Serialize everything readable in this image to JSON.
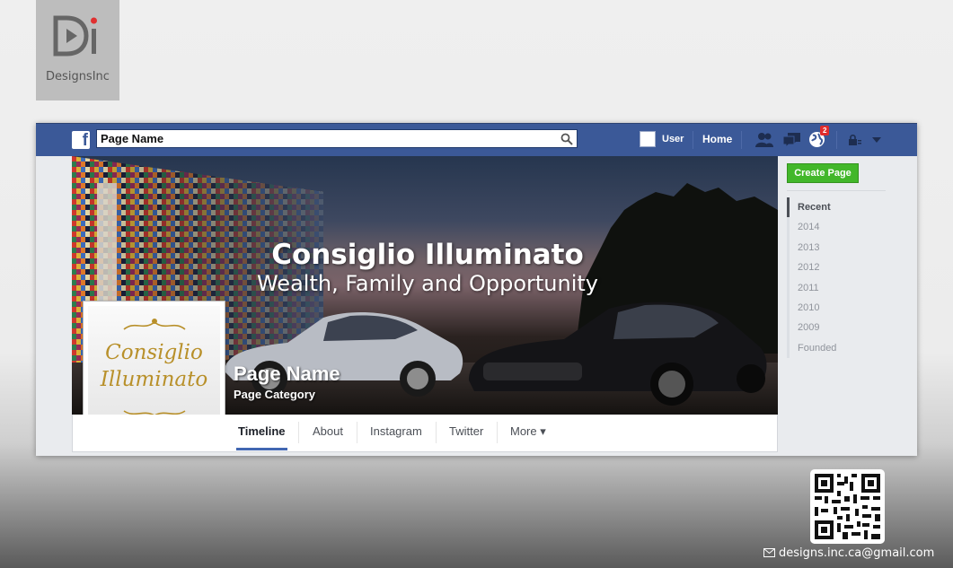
{
  "brand": {
    "name": "DesignsInc"
  },
  "topbar": {
    "search_value": "Page Name",
    "user_label": "User",
    "home_label": "Home",
    "notification_count": "2"
  },
  "cover": {
    "title": "Consiglio Illuminato",
    "subtitle": "Wealth, Family and Opportunity"
  },
  "page": {
    "name": "Page Name",
    "category": "Page Category",
    "logo_line1": "Consiglio",
    "logo_line2": "Illuminato"
  },
  "tabs": [
    {
      "label": "Timeline"
    },
    {
      "label": "About"
    },
    {
      "label": "Instagram"
    },
    {
      "label": "Twitter"
    },
    {
      "label": "More ▾"
    }
  ],
  "sidebar": {
    "create_page_label": "Create Page",
    "years": [
      {
        "label": "Recent"
      },
      {
        "label": "2014"
      },
      {
        "label": "2013"
      },
      {
        "label": "2012"
      },
      {
        "label": "2011"
      },
      {
        "label": "2010"
      },
      {
        "label": "2009"
      },
      {
        "label": "Founded"
      }
    ]
  },
  "footer": {
    "email": "designs.inc.ca@gmail.com"
  },
  "colors": {
    "facebook_blue": "#3b5998",
    "create_green": "#42b72a",
    "gold": "#b8902a"
  }
}
